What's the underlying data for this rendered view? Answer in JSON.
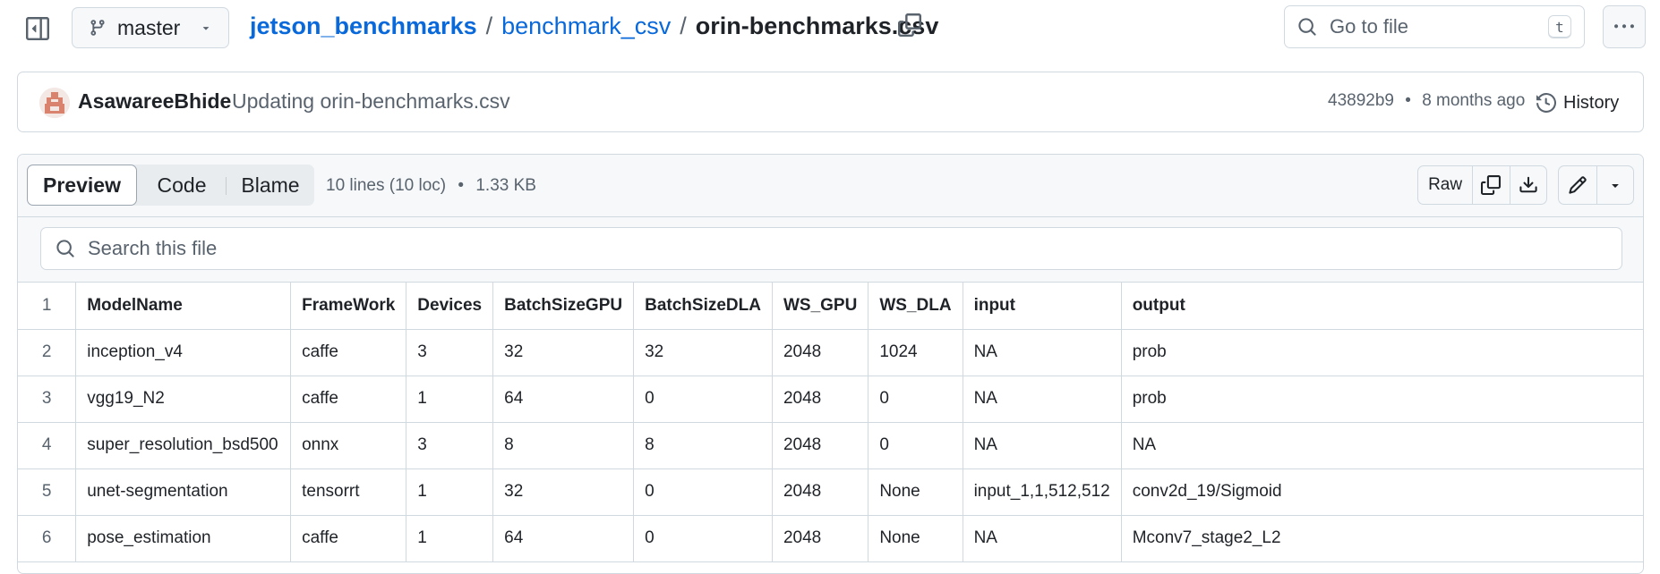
{
  "repo": {
    "branch": "master",
    "breadcrumb": {
      "repo": "jetson_benchmarks",
      "sep1": "/",
      "dir": "benchmark_csv",
      "sep2": "/",
      "file": "orin-benchmarks.csv"
    }
  },
  "goto_file": {
    "placeholder": "Go to file",
    "shortcut": "t"
  },
  "commit": {
    "author": "AsawareeBhide",
    "message": "Updating orin-benchmarks.csv",
    "sha": "43892b9",
    "separator": "•",
    "age": "8 months ago",
    "history_label": "History"
  },
  "file_header": {
    "tabs": {
      "preview": "Preview",
      "code": "Code",
      "blame": "Blame"
    },
    "lines": "10 lines (10 loc)",
    "dot": "•",
    "size": "1.33 KB",
    "raw_label": "Raw"
  },
  "search": {
    "placeholder": "Search this file"
  },
  "table": {
    "rows": [
      {
        "ln": "1",
        "cells": [
          "ModelName",
          "FrameWork",
          "Devices",
          "BatchSizeGPU",
          "BatchSizeDLA",
          "WS_GPU",
          "WS_DLA",
          "input",
          "output"
        ]
      },
      {
        "ln": "2",
        "cells": [
          "inception_v4",
          "caffe",
          "3",
          "32",
          "32",
          "2048",
          "1024",
          "NA",
          "prob"
        ]
      },
      {
        "ln": "3",
        "cells": [
          "vgg19_N2",
          "caffe",
          "1",
          "64",
          "0",
          "2048",
          "0",
          "NA",
          "prob"
        ]
      },
      {
        "ln": "4",
        "cells": [
          "super_resolution_bsd500",
          "onnx",
          "3",
          "8",
          "8",
          "2048",
          "0",
          "NA",
          "NA"
        ]
      },
      {
        "ln": "5",
        "cells": [
          "unet-segmentation",
          "tensorrt",
          "1",
          "32",
          "0",
          "2048",
          "None",
          "input_1,1,512,512",
          "conv2d_19/Sigmoid"
        ]
      },
      {
        "ln": "6",
        "cells": [
          "pose_estimation",
          "caffe",
          "1",
          "64",
          "0",
          "2048",
          "None",
          "NA",
          "Mconv7_stage2_L2"
        ]
      }
    ]
  },
  "colors": {
    "link": "#0969da",
    "text": "#1f2328",
    "muted": "#59636e",
    "border": "#d1d9e0",
    "canvas_subtle": "#f6f8fa"
  },
  "icons": [
    "sidebar-expand-icon",
    "git-branch-icon",
    "triangle-down-icon",
    "copy-icon",
    "search-icon",
    "kebab-horizontal-icon",
    "history-icon",
    "download-icon",
    "pencil-icon"
  ]
}
